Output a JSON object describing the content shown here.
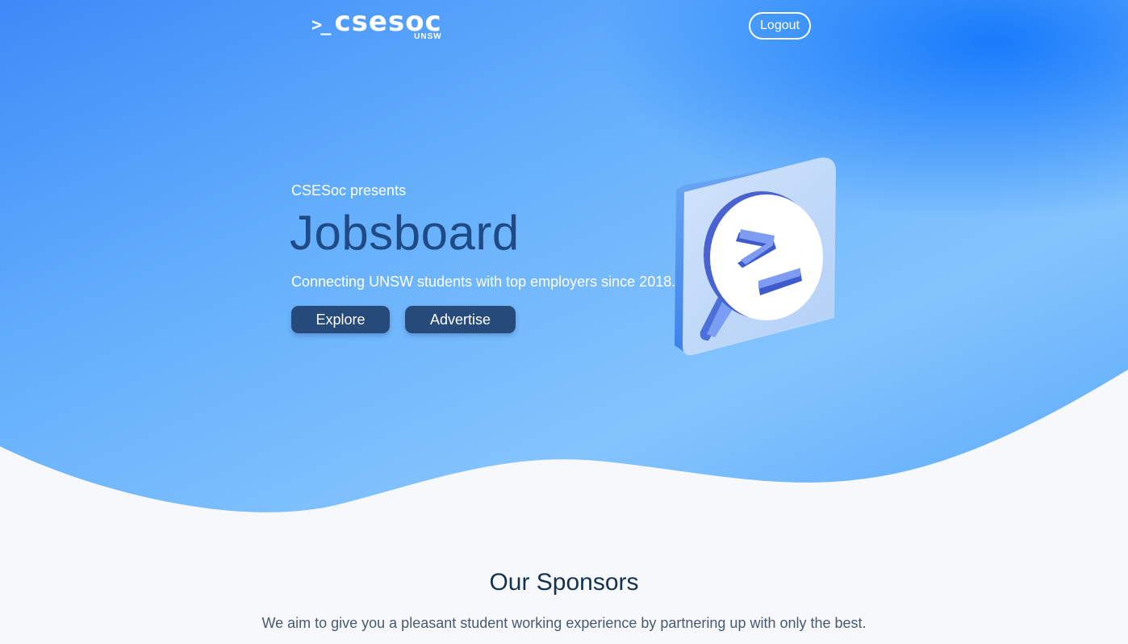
{
  "brand": {
    "prompt": ">_",
    "name": "csesoc",
    "sub": "UNSW"
  },
  "header": {
    "logout_label": "Logout"
  },
  "hero": {
    "presents": "CSESoc presents",
    "title": "Jobsboard",
    "tagline": "Connecting UNSW students with top employers since 2018.",
    "explore_label": "Explore",
    "advertise_label": "Advertise",
    "illustration_icon": "magnifier-terminal-icon"
  },
  "sponsors": {
    "title": "Our Sponsors",
    "description": "We aim to give you a pleasant student working experience by partnering up with only the best."
  },
  "colors": {
    "hero_blue": "#3f8ffb",
    "hero_light": "#8cc8fd",
    "accent_dark": "#264a7a",
    "title_blue": "#1f4a86",
    "page_bg": "#f6f8fc"
  }
}
